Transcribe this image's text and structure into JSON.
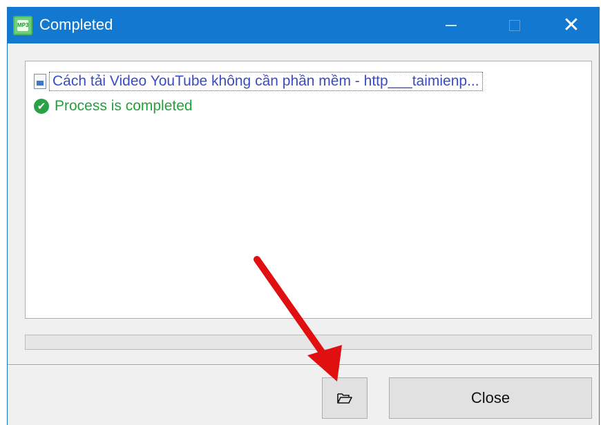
{
  "window": {
    "title": "Completed",
    "app_icon": "mp3-app-icon",
    "title_bar_color": "#1379d0"
  },
  "list": {
    "items": [
      {
        "icon": "file-icon",
        "text": "Cách tải Video YouTube không cần phần mềm - http___taimienp..."
      },
      {
        "icon": "checkmark-icon",
        "text": "Process is completed"
      }
    ]
  },
  "progress": {
    "fraction": 0
  },
  "buttons": {
    "open_folder_icon": "open-folder-icon",
    "close_label": "Close"
  },
  "annotation": {
    "arrow_color": "#e01010"
  }
}
